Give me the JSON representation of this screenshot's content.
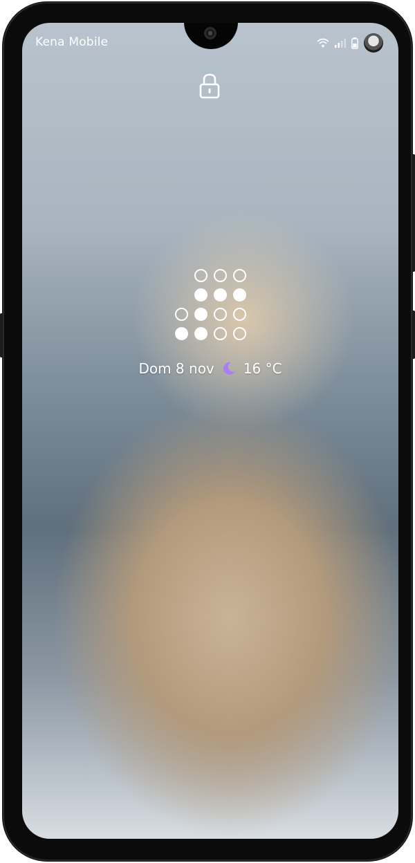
{
  "status_bar": {
    "carrier": "Kena Mobile",
    "icons": [
      "wifi-icon",
      "signal-icon",
      "battery-icon",
      "avatar"
    ]
  },
  "lock_screen": {
    "lock_icon": "lock-icon",
    "clock_pattern": [
      [
        "blank",
        "empty",
        "empty",
        "empty"
      ],
      [
        "blank",
        "filled",
        "filled",
        "filled"
      ],
      [
        "empty",
        "filled",
        "empty",
        "empty"
      ],
      [
        "filled",
        "filled",
        "empty",
        "empty"
      ]
    ],
    "date": "Dom 8 nov",
    "weather_icon": "moon-icon",
    "temperature": "16 °C"
  },
  "colors": {
    "text": "#ffffff",
    "moon": "#a97ef2"
  }
}
